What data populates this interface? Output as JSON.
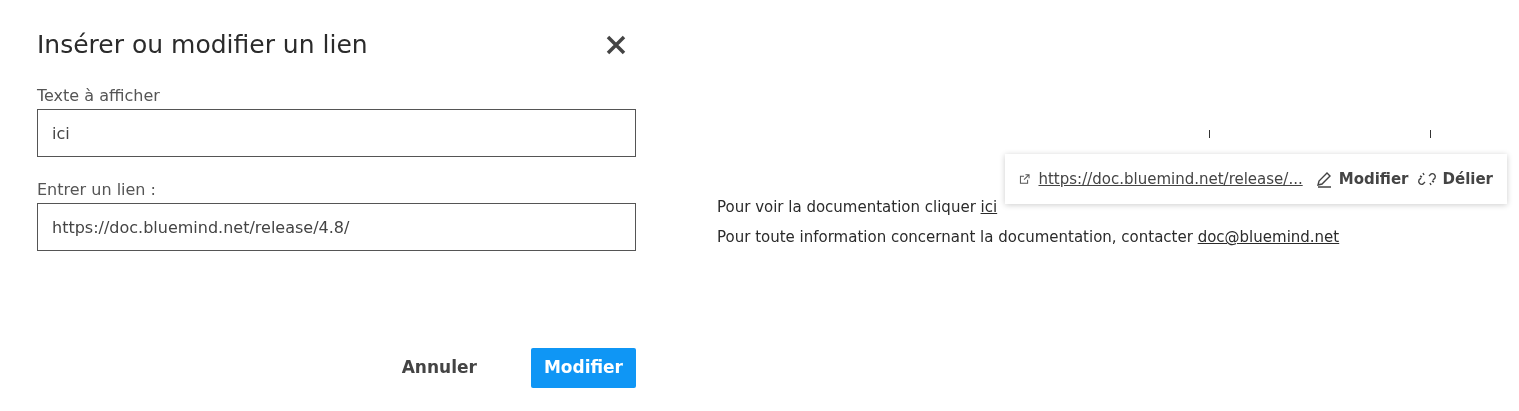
{
  "dialog": {
    "title": "Insérer ou modifier un lien",
    "fields": [
      {
        "label": "Texte à afficher",
        "value": "ici"
      },
      {
        "label": "Entrer un lien :",
        "value": "https://doc.bluemind.net/release/4.8/"
      }
    ],
    "buttons": [
      {
        "label": "Annuler",
        "kind": "secondary"
      },
      {
        "label": "Modifier",
        "kind": "primary"
      }
    ]
  },
  "editor": {
    "lines": [
      {
        "text": "Pour voir la documentation cliquer ",
        "link": "ici"
      },
      {
        "text": "Pour toute information concernant la documentation, contacter ",
        "link": "doc@bluemind.net"
      }
    ],
    "link_popup": {
      "url": "https://doc.bluemind.net/release/...",
      "edit": "Modifier",
      "unlink": "Délier"
    }
  }
}
